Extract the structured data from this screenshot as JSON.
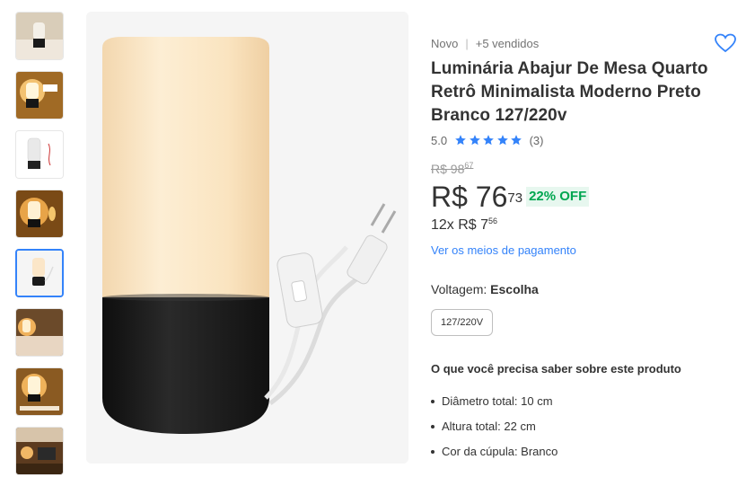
{
  "product": {
    "condition": "Novo",
    "sold": "+5 vendidos",
    "title": "Luminária Abajur De Mesa Quarto Retrô Minimalista Moderno Preto Branco 127/220v",
    "rating": "5.0",
    "rating_stars": 5,
    "reviews": "(3)",
    "favorite_icon": "heart-outline-icon"
  },
  "pricing": {
    "old_currency": "R$ 98",
    "old_cents": "67",
    "price_currency": "R$ 76",
    "price_cents": "73",
    "discount": "22% OFF",
    "installments": "12x R$ 7",
    "installments_cents": "56",
    "payment_link": "Ver os meios de pagamento"
  },
  "variation": {
    "label": "Voltagem:",
    "selected": "Escolha",
    "options": [
      "127/220V"
    ]
  },
  "specs": {
    "title": "O que você precisa saber sobre este produto",
    "items": [
      "Diâmetro total: 10 cm",
      "Altura total: 22 cm",
      "Cor da cúpula: Branco"
    ]
  },
  "colors": {
    "accent": "#3483fa",
    "discount_green": "#00a650",
    "lamp_glow": "#fbe6c8",
    "lamp_base": "#1a1a1a"
  }
}
